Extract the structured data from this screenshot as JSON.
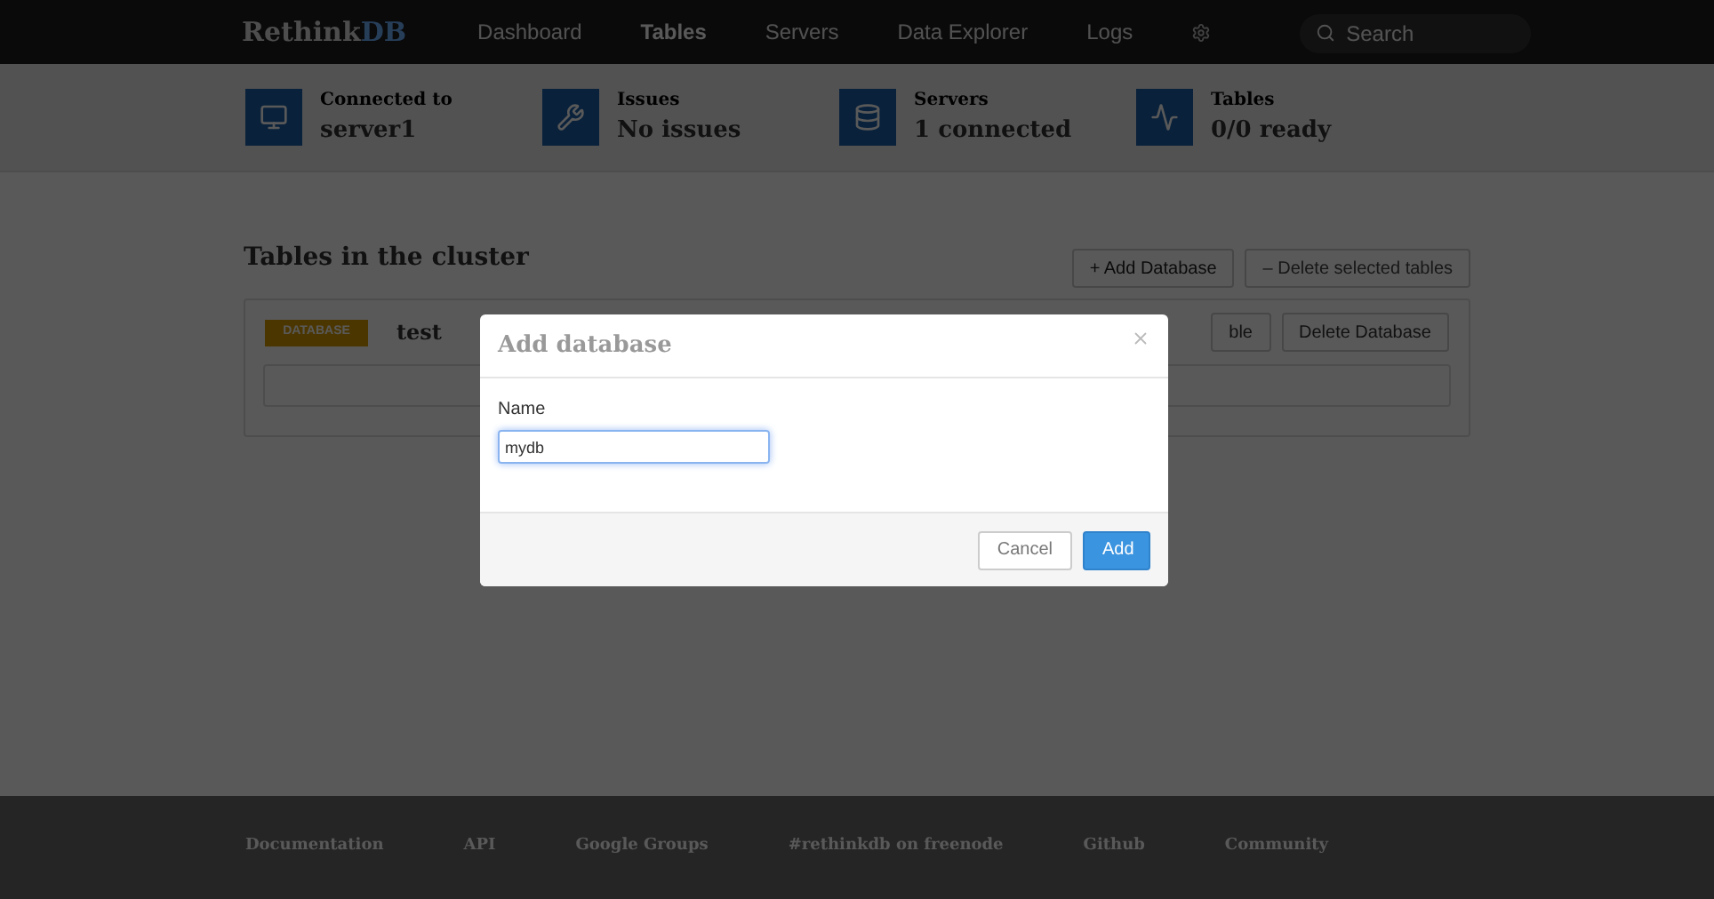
{
  "navbar": {
    "logo_main": "Rethink",
    "logo_accent": "DB",
    "links": [
      {
        "label": "Dashboard",
        "selected": false
      },
      {
        "label": "Tables",
        "selected": true
      },
      {
        "label": "Servers",
        "selected": false
      },
      {
        "label": "Data Explorer",
        "selected": false
      },
      {
        "label": "Logs",
        "selected": false
      }
    ],
    "search": {
      "placeholder": "Search"
    }
  },
  "stats": [
    {
      "kind": "monitor",
      "label": "Connected to",
      "value": "server1"
    },
    {
      "kind": "wrench",
      "label": "Issues",
      "value": "No issues"
    },
    {
      "kind": "database",
      "label": "Servers",
      "value": "1 connected"
    },
    {
      "kind": "pulse",
      "label": "Tables",
      "value": "0/0 ready"
    }
  ],
  "tables_section": {
    "title": "Tables in the cluster",
    "buttons": [
      "+ Add Database",
      "– Delete selected tables"
    ],
    "database": {
      "badge": "DATABASE",
      "name": "test",
      "buttons": [
        "ble",
        "Delete Database"
      ]
    }
  },
  "modal": {
    "title": "Add database",
    "field": {
      "label": "Name",
      "value": "mydb"
    },
    "buttons": [
      {
        "label": "Cancel",
        "kind": "default"
      },
      {
        "label": "Add",
        "kind": "primary"
      }
    ]
  },
  "footer": {
    "links": [
      "Documentation",
      "API",
      "Google Groups",
      "#rethinkdb on freenode",
      "Github",
      "Community"
    ]
  }
}
